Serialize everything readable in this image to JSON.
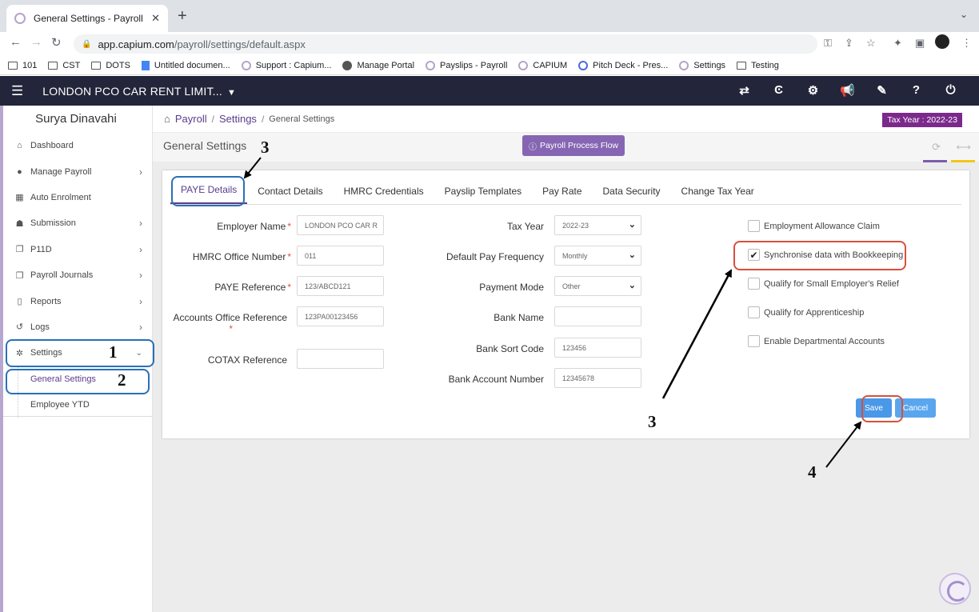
{
  "browser": {
    "tab_title": "General Settings - Payroll",
    "new_tab": "+",
    "url_host": "app.capium.com",
    "url_path": "/payroll/settings/default.aspx",
    "bookmarks": [
      "101",
      "CST",
      "DOTS",
      "Untitled documen...",
      "Support : Capium...",
      "Manage Portal",
      "Payslips - Payroll",
      "CAPIUM",
      "Pitch Deck - Pres...",
      "Settings",
      "Testing"
    ]
  },
  "header": {
    "company": "LONDON PCO CAR RENT LIMIT...",
    "icons": [
      "transfer-icon",
      "capium-icon",
      "network-icon",
      "megaphone-icon",
      "ticket-icon",
      "help-icon",
      "power-icon"
    ]
  },
  "sidebar": {
    "user": "Surya Dinavahi",
    "items": [
      {
        "label": "Dashboard",
        "icon": "home-icon"
      },
      {
        "label": "Manage Payroll",
        "icon": "user-icon"
      },
      {
        "label": "Auto Enrolment",
        "icon": "grid-icon"
      },
      {
        "label": "Submission",
        "icon": "users-icon"
      },
      {
        "label": "P11D",
        "icon": "copy-icon"
      },
      {
        "label": "Payroll Journals",
        "icon": "copy-icon"
      },
      {
        "label": "Reports",
        "icon": "report-icon"
      },
      {
        "label": "Logs",
        "icon": "history-icon"
      },
      {
        "label": "Settings",
        "icon": "gear-icon"
      }
    ],
    "sub_items": [
      "General Settings",
      "Employee YTD"
    ]
  },
  "breadcrumb": {
    "root": "Payroll",
    "parent": "Settings",
    "current": "General Settings"
  },
  "tax_year_badge": "Tax Year : 2022-23",
  "page_title": "General Settings",
  "process_flow_button": "Payroll Process Flow",
  "tabs": [
    "PAYE Details",
    "Contact Details",
    "HMRC Credentials",
    "Payslip Templates",
    "Pay Rate",
    "Data Security",
    "Change Tax Year"
  ],
  "form": {
    "employer_name": {
      "label": "Employer Name",
      "value": "LONDON PCO CAR R"
    },
    "hmrc_office_number": {
      "label": "HMRC Office Number",
      "value": "011"
    },
    "paye_reference": {
      "label": "PAYE Reference",
      "value": "123/ABCD121"
    },
    "accounts_office_reference": {
      "label": "Accounts Office Reference",
      "value": "123PA00123456"
    },
    "cotax_reference": {
      "label": "COTAX Reference",
      "value": ""
    },
    "tax_year": {
      "label": "Tax Year",
      "value": "2022-23"
    },
    "default_pay_frequency": {
      "label": "Default Pay Frequency",
      "value": "Monthly"
    },
    "payment_mode": {
      "label": "Payment Mode",
      "value": "Other"
    },
    "bank_name": {
      "label": "Bank Name",
      "value": ""
    },
    "bank_sort_code": {
      "label": "Bank Sort Code",
      "value": "123456"
    },
    "bank_account_number": {
      "label": "Bank Account Number",
      "value": "12345678"
    },
    "required_mark": "*"
  },
  "checkboxes": [
    {
      "label": "Employment Allowance Claim",
      "checked": false
    },
    {
      "label": "Synchronise data with Bookkeeping",
      "checked": true,
      "mark": "✔"
    },
    {
      "label": "Qualify for Small Employer's Relief",
      "checked": false
    },
    {
      "label": "Qualify for Apprenticeship",
      "checked": false
    },
    {
      "label": "Enable Departmental Accounts",
      "checked": false
    }
  ],
  "buttons": {
    "save": "Save",
    "cancel": "Cancel"
  },
  "annotations": [
    "1",
    "2",
    "3",
    "3",
    "4"
  ],
  "colors": {
    "header_bg": "#23263a",
    "accent_purple": "#5a3d8c",
    "badge": "#7b2a8c",
    "button_blue": "#4a98e8",
    "annotation_red": "#d7503c",
    "annotation_blue": "#2a70b8"
  }
}
